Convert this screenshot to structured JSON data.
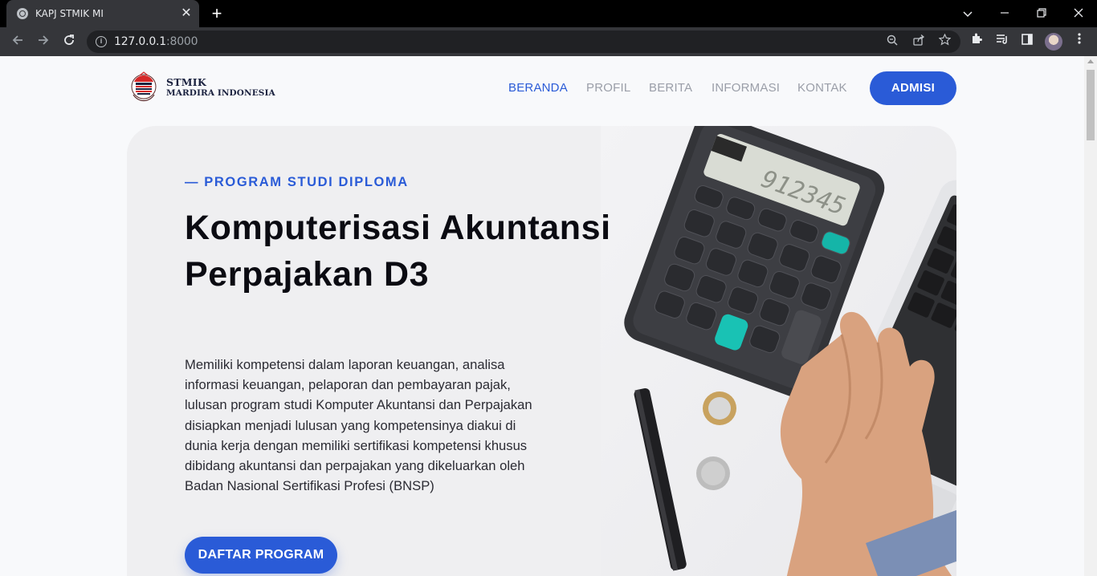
{
  "browser": {
    "tab_title": "KAPJ STMIK MI",
    "tab_close": "✕",
    "new_tab": "+",
    "url_host": "127.0.0.1",
    "url_port": ":8000"
  },
  "site": {
    "logo_line1": "STMIK",
    "logo_line2": "MARDIRA INDONESIA"
  },
  "nav": {
    "items": [
      {
        "label": "BERANDA",
        "active": true
      },
      {
        "label": "PROFIL"
      },
      {
        "label": "BERITA"
      },
      {
        "label": "INFORMASI"
      },
      {
        "label": "KONTAK"
      }
    ],
    "cta_label": "ADMISI"
  },
  "hero": {
    "eyebrow": "— PROGRAM STUDI DIPLOMA",
    "headline": "Komputerisasi Akuntansi Perpajakan D3",
    "description": "Memiliki kompetensi dalam laporan keuangan, analisa informasi keuangan, pelaporan dan pembayaran pajak, lulusan program studi Komputer Akuntansi dan Perpajakan disiapkan menjadi lulusan yang kompetensinya diakui di dunia kerja dengan memiliki sertifikasi kompetensi khusus dibidang akuntansi dan perpajakan yang dikeluarkan oleh Badan Nasional Sertifikasi Profesi (BNSP)",
    "cta_label": "DAFTAR PROGRAM",
    "calculator_display": "912345"
  },
  "colors": {
    "accent": "#2a5bd7",
    "text_dark": "#0b0b12",
    "nav_inactive": "#9a9ea8"
  }
}
